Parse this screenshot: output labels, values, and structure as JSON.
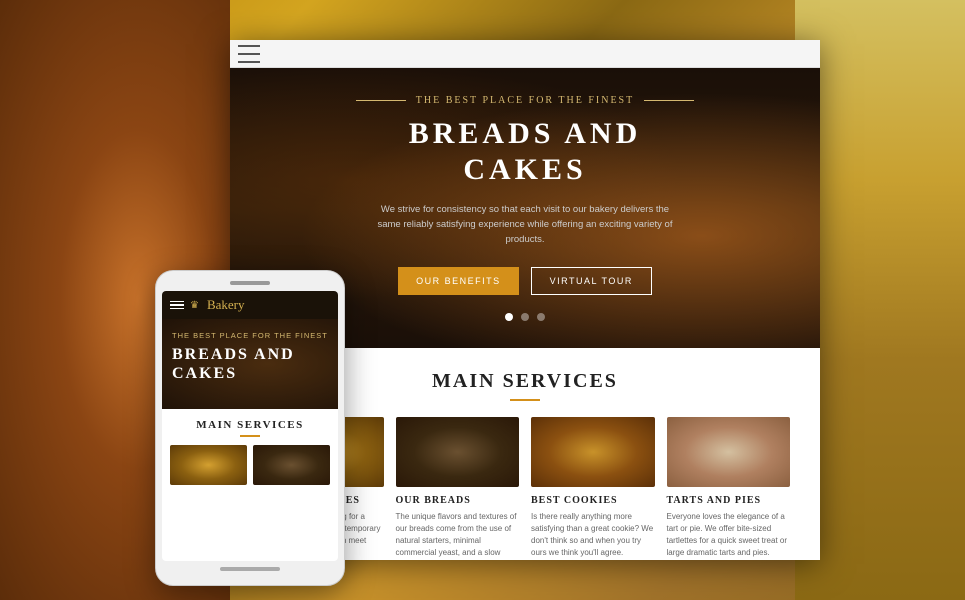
{
  "background": {
    "color": "#c8a060"
  },
  "browser": {
    "toolbar": {
      "menu_icon_label": "menu"
    },
    "hero": {
      "subtitle": "THE BEST PLACE FOR THE FINEST",
      "title": "BREADS AND\nCAKES",
      "description": "We strive for consistency so that each visit to our bakery delivers the same reliably satisfying experience while offering an exciting variety of products.",
      "btn_primary": "OUR BENEFITS",
      "btn_secondary": "VIRTUAL TOUR",
      "dots": [
        true,
        false,
        false
      ]
    },
    "services": {
      "title": "MAIN SERVICES",
      "items": [
        {
          "name": "WEDDING CAKES",
          "desc": "Whether you are looking for a traditional style or a contemporary plan, our decorators can meet your individual needs.",
          "img_class": "service-img-1"
        },
        {
          "name": "OUR BREADS",
          "desc": "The unique flavors and textures of our breads come from the use of natural starters, minimal commercial yeast, and a slow fermentation process.",
          "img_class": "service-img-2"
        },
        {
          "name": "BEST COOKIES",
          "desc": "Is there really anything more satisfying than a great cookie? We don't think so and when you try ours we think you'll agree.",
          "img_class": "service-img-3"
        },
        {
          "name": "TARTS AND PIES",
          "desc": "Everyone loves the elegance of a tart or pie. We offer bite-sized tartlettes for a quick sweet treat or large dramatic tarts and pies.",
          "img_class": "service-img-4"
        }
      ]
    }
  },
  "phone": {
    "logo_text": "Bakery",
    "hero_sub": "THE BEST PLACE FOR THE FINEST",
    "hero_title": "BREADS AND\nCAKES",
    "services_title": "MAIN SERVICES"
  }
}
